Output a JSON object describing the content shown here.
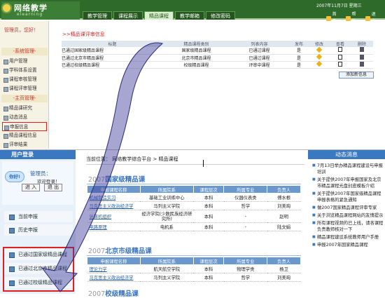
{
  "header": {
    "logo_title": "网络教学",
    "logo_sub": "elearning",
    "date": "2007年11月7日 星期三",
    "nav": [
      "教学管理",
      "课程展示",
      "精品课程",
      "教学邮箱",
      "修改密码"
    ],
    "active_nav": 2,
    "tools": [
      "首页",
      "帮助",
      "退出"
    ]
  },
  "admin_sidebar": {
    "greeting": "管理员，您好！",
    "sections": [
      {
        "title": "-系统管理-",
        "items": [
          "用户管理",
          "学科体系设置",
          "课程审核管理",
          "课程评审管理"
        ]
      },
      {
        "title": "-主页管理-",
        "items": [
          "精品课研究",
          "动态消息",
          "申报信息",
          "精品课程信息",
          "评审结果"
        ]
      }
    ],
    "highlighted_item": "申报信息"
  },
  "admin_panel": {
    "title": ">>精品课评审信息",
    "columns": [
      "标题",
      "精品课程类别",
      "列表内容",
      "发布",
      "修改",
      "查看",
      "删除"
    ],
    "rows": [
      {
        "title": "已通过国家级精品课程",
        "category": "国家级精品课程",
        "content": "已通过课程",
        "publish": "是"
      },
      {
        "title": "已通过北京市精品课程",
        "category": "北京市精品课程",
        "content": "已通过课程",
        "publish": "是"
      },
      {
        "title": "已通过校级精品课程",
        "category": "校级精品课程",
        "content": "评审中课程",
        "publish": "是"
      }
    ],
    "add_button": "添加新信息"
  },
  "front": {
    "login": {
      "head": "用户登录",
      "bubble": "你好!",
      "admin": "管理员：",
      "welcome": "欢迎登录！",
      "enter_btn": "进 入",
      "exit_btn": "退 出"
    },
    "left_menu": [
      "当前申报",
      "历史申报"
    ],
    "passed_menu": [
      "已通过国家级精品课程",
      "已通过北京市精品课程",
      "已通过校级精品课程"
    ],
    "breadcrumb": "当前位置： 网络教学综合平台 > 精品课程",
    "sections": [
      {
        "year": "2007",
        "title": "国家级精品课",
        "columns": [
          "申报课程名称",
          "所属院系",
          "课程层次",
          "所属专业",
          "负责人"
        ],
        "rows": [
          [
            "机械制造实习",
            "基础工业训练中心",
            "本科",
            "仪器仪表类",
            "傅水根"
          ],
          [
            "马克思主义政治经济学",
            "马列主义学院",
            "本科",
            "哲学",
            "刘美珣"
          ],
          [
            "计算机组织",
            "经济学院(少数民族经济研究所)",
            "本科",
            "-",
            "赵明"
          ],
          [
            "电路原理",
            "电机系",
            "本科",
            "-",
            "陆文娟"
          ]
        ]
      },
      {
        "year": "2007",
        "title": "北京市级精品课",
        "columns": [
          "申报课程名称",
          "所属院系",
          "课程层次",
          "所属专业",
          "负责人"
        ],
        "rows": [
          [
            "理论力学",
            "航天航空学院",
            "本科",
            "物理学类",
            "杨卫"
          ],
          [
            "马克思主义政治经济学",
            "马列主义学院",
            "本科",
            "哲学",
            "刘美珣"
          ]
        ]
      },
      {
        "year": "2007",
        "title": "校级精品课",
        "columns": [],
        "rows": []
      }
    ],
    "news_head": "动态消息",
    "news": [
      "7月13日举办精品课程建设与申报培训",
      "关于提供2007年申报国家及北京市精品课程光盘封皮模板介绍",
      "关于提供2007年国家级精品课程申报表格的紧急通知",
      "做2007国家精品课程评审专家",
      "关于浏览精品课程网站的友情提示",
      "所有课程视频的已上线，请各课程负责教师核对一下",
      "精品课程建设系统教师用户手册",
      "申报2007年国家精品课程"
    ]
  },
  "colors": {
    "admin_green": "#2e6b2a",
    "front_blue": "#3b78c2",
    "arrow_purple": "#3a3a9a",
    "highlight_red": "#e02020"
  }
}
